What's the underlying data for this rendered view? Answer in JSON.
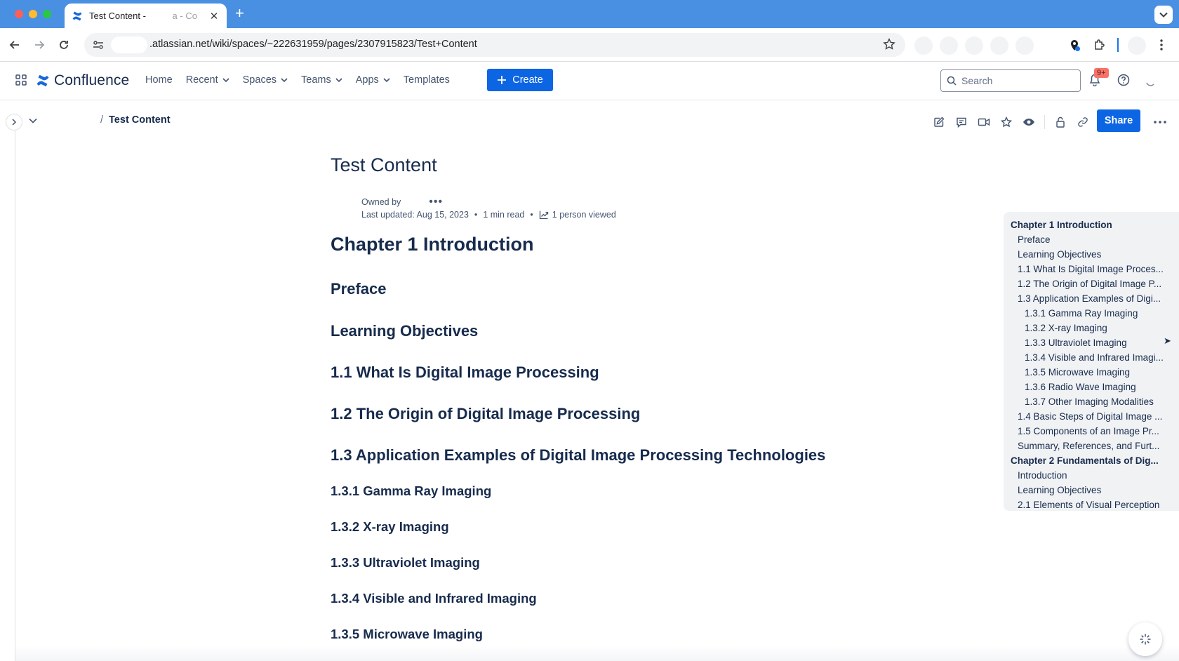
{
  "browser": {
    "tab_title": "Test Content - ",
    "tab_title_suffix": "a - Co",
    "url_prefix": "",
    "url": ".atlassian.net/wiki/spaces/~222631959/pages/2307915823/Test+Content"
  },
  "header": {
    "product": "Confluence",
    "nav": [
      {
        "label": "Home",
        "has_menu": false
      },
      {
        "label": "Recent",
        "has_menu": true
      },
      {
        "label": "Spaces",
        "has_menu": true
      },
      {
        "label": "Teams",
        "has_menu": true
      },
      {
        "label": "Apps",
        "has_menu": true
      },
      {
        "label": "Templates",
        "has_menu": false
      }
    ],
    "create_label": "Create",
    "search_placeholder": "Search",
    "notification_badge": "9+"
  },
  "breadcrumb": {
    "separator": "/",
    "current": "Test Content"
  },
  "page_actions": {
    "share_label": "Share",
    "icons": [
      "edit-icon",
      "comment-icon",
      "video-icon",
      "star-icon",
      "watch-icon",
      "lock-icon",
      "link-icon"
    ]
  },
  "page": {
    "title": "Test Content",
    "owned_by_label": "Owned by",
    "last_updated": "Last updated: Aug 15, 2023",
    "read_time": "1 min read",
    "views": "1 person viewed"
  },
  "headings": [
    {
      "text": "Chapter 1 Introduction",
      "level": 1
    },
    {
      "text": "Preface",
      "level": 2
    },
    {
      "text": "Learning Objectives",
      "level": 2
    },
    {
      "text": "1.1 What Is Digital Image Processing",
      "level": 2
    },
    {
      "text": "1.2 The Origin of Digital Image Processing",
      "level": 2
    },
    {
      "text": "1.3 Application Examples of Digital Image Processing Technologies",
      "level": 2
    },
    {
      "text": "1.3.1 Gamma Ray Imaging",
      "level": 3
    },
    {
      "text": "1.3.2 X-ray Imaging",
      "level": 3
    },
    {
      "text": "1.3.3 Ultraviolet Imaging",
      "level": 3
    },
    {
      "text": "1.3.4 Visible and Infrared Imaging",
      "level": 3
    },
    {
      "text": "1.3.5 Microwave Imaging",
      "level": 3
    }
  ],
  "toc": [
    {
      "text": "Chapter 1 Introduction",
      "indent": 0,
      "bold": true
    },
    {
      "text": "Preface",
      "indent": 1,
      "bold": false
    },
    {
      "text": "Learning Objectives",
      "indent": 1,
      "bold": false
    },
    {
      "text": "1.1 What Is Digital Image Proces...",
      "indent": 1,
      "bold": false
    },
    {
      "text": "1.2 The Origin of Digital Image P...",
      "indent": 1,
      "bold": false
    },
    {
      "text": "1.3 Application Examples of Digi...",
      "indent": 1,
      "bold": false
    },
    {
      "text": "1.3.1 Gamma Ray Imaging",
      "indent": 2,
      "bold": false
    },
    {
      "text": "1.3.2 X-ray Imaging",
      "indent": 2,
      "bold": false
    },
    {
      "text": "1.3.3 Ultraviolet Imaging",
      "indent": 2,
      "bold": false
    },
    {
      "text": "1.3.4 Visible and Infrared Imagi...",
      "indent": 2,
      "bold": false
    },
    {
      "text": "1.3.5 Microwave Imaging",
      "indent": 2,
      "bold": false
    },
    {
      "text": "1.3.6 Radio Wave Imaging",
      "indent": 2,
      "bold": false
    },
    {
      "text": "1.3.7 Other Imaging Modalities",
      "indent": 2,
      "bold": false
    },
    {
      "text": "1.4 Basic Steps of Digital Image ...",
      "indent": 1,
      "bold": false
    },
    {
      "text": "1.5 Components of an Image Pr...",
      "indent": 1,
      "bold": false
    },
    {
      "text": "Summary, References, and Furt...",
      "indent": 1,
      "bold": false
    },
    {
      "text": "Chapter 2 Fundamentals of Dig...",
      "indent": 0,
      "bold": true
    },
    {
      "text": "Introduction",
      "indent": 1,
      "bold": false
    },
    {
      "text": "Learning Objectives",
      "indent": 1,
      "bold": false
    },
    {
      "text": "2.1 Elements of Visual Perception",
      "indent": 1,
      "bold": false
    }
  ],
  "colors": {
    "primary": "#0c66e4",
    "chrome_blue": "#4a90e2",
    "text": "#172b4d",
    "badge": "#f87168"
  }
}
